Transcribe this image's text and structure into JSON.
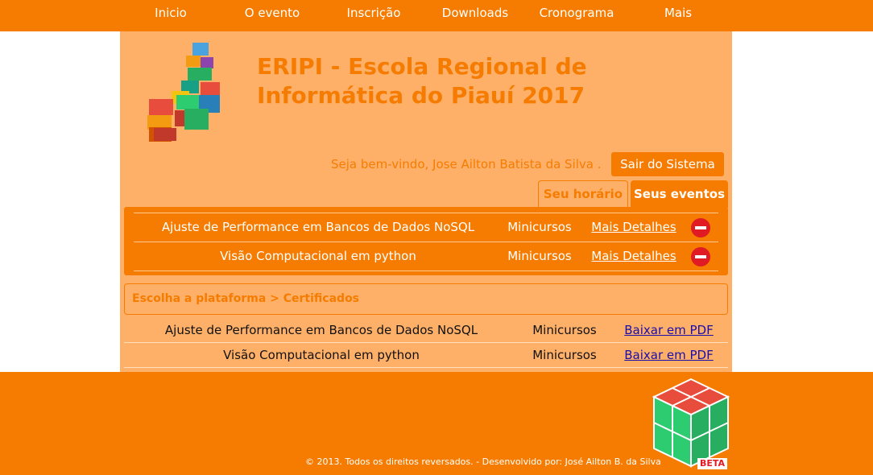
{
  "nav": {
    "items": [
      {
        "label": "Inicio"
      },
      {
        "label": "O evento"
      },
      {
        "label": "Inscrição"
      },
      {
        "label": "Downloads"
      },
      {
        "label": "Cronograma"
      },
      {
        "label": "Mais"
      }
    ]
  },
  "header": {
    "title": "ERIPI - Escola Regional de Informática do Piauí 2017",
    "welcome": "Seja bem-vindo, Jose Ailton Batista da Silva .",
    "logout_label": "Sair do Sistema"
  },
  "tabs": {
    "horario": "Seu horário",
    "eventos": "Seus eventos"
  },
  "events": [
    {
      "name": "Ajuste de Performance em Bancos de Dados NoSQL",
      "type": "Minicursos",
      "details": "Mais Detalhes"
    },
    {
      "name": "Visão Computacional em python",
      "type": "Minicursos",
      "details": "Mais Detalhes"
    }
  ],
  "breadcrumb": {
    "text": "Escolha a plataforma > Certificados"
  },
  "certificates": [
    {
      "name": "Ajuste de Performance em Bancos de Dados NoSQL",
      "type": "Minicursos",
      "download": "Baixar em PDF"
    },
    {
      "name": "Visão Computacional em python",
      "type": "Minicursos",
      "download": "Baixar em PDF"
    }
  ],
  "footer": {
    "copyright": "© 2013. Todos os direitos reversados. - Desenvolvido por: José Ailton B. da Silva",
    "badge": "BETA"
  },
  "colors": {
    "brand": "#f57c00",
    "panel": "#ffb068",
    "remove": "#e01b24",
    "link": "#1a0dab"
  }
}
